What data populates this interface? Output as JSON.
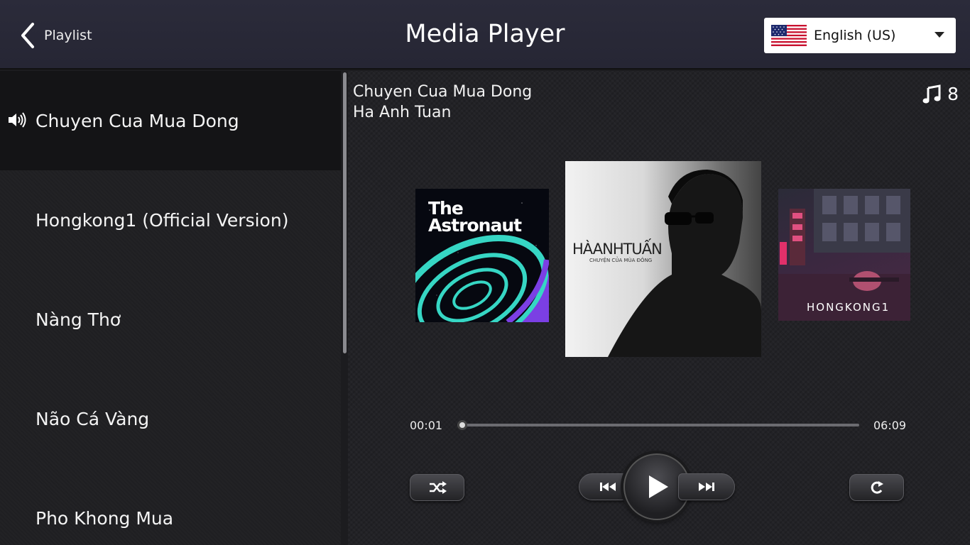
{
  "header": {
    "back_label": "Playlist",
    "title": "Media Player",
    "language": "English (US)",
    "language_flag": "us-flag-icon"
  },
  "playlist": {
    "items": [
      {
        "label": "Chuyen Cua Mua Dong",
        "active": true
      },
      {
        "label": "Hongkong1 (Official Version)",
        "active": false
      },
      {
        "label": "Nàng Thơ",
        "active": false
      },
      {
        "label": "Não Cá Vàng",
        "active": false
      },
      {
        "label": "Pho Khong Mua",
        "active": false
      }
    ]
  },
  "now_playing": {
    "title": "Chuyen Cua Mua Dong",
    "artist": "Ha Anh Tuan",
    "track_count": "8",
    "current_time": "00:01",
    "total_time": "06:09",
    "progress": 0.003
  },
  "covers": {
    "left_text": "The Astronaut",
    "center_text": "HÀANHTUẤN",
    "center_subtext": "CHUYỆN CỦA MÙA ĐÔNG",
    "right_text": "HONGKONG1"
  },
  "colors": {
    "header_bg": "#2b2b3a",
    "sidebar_bg": "#1f1f22",
    "active_item_bg": "#141416",
    "accent_teal": "#36d6c4",
    "accent_purple": "#7b3fe4"
  },
  "icons": {
    "back": "chevron-left-icon",
    "speaker": "speaker-icon",
    "music_note": "music-note-icon",
    "shuffle": "shuffle-icon",
    "prev": "skip-previous-icon",
    "play": "play-icon",
    "next": "skip-next-icon",
    "repeat": "repeat-icon"
  }
}
